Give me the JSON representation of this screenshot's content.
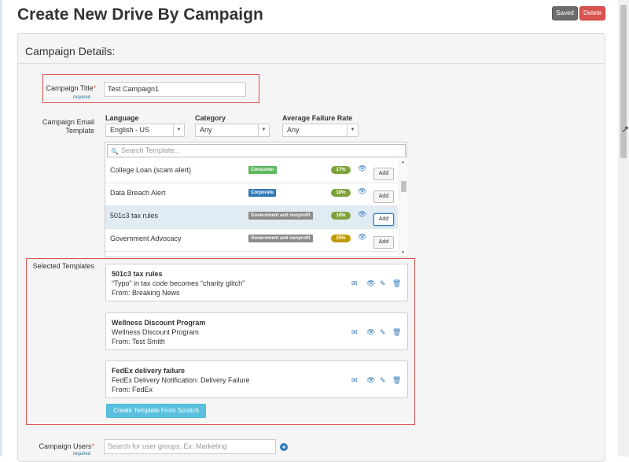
{
  "page": {
    "title": "Create New Drive By Campaign"
  },
  "actions": {
    "saved_label": "Saved",
    "delete_label": "Delete"
  },
  "panel": {
    "title": "Campaign Details:"
  },
  "campaign_title": {
    "label": "Campaign Title",
    "star": "*",
    "required_note": "required",
    "value": "Test Campaign1"
  },
  "email_template": {
    "label_line1": "Campaign Email",
    "label_line2": "Template",
    "language": {
      "label": "Language",
      "value": "English - US"
    },
    "category": {
      "label": "Category",
      "value": "Any"
    },
    "failure_rate": {
      "label": "Average Failure Rate",
      "value": "Any"
    },
    "search_placeholder": "Search Template...",
    "rows": [
      {
        "name": "College Loan (scam alert)",
        "tag": "Consumer",
        "tag_color": "#5cb85c",
        "pct": "17%",
        "pct_color": "#7fa33a",
        "add": "Add"
      },
      {
        "name": "Data Breach Alert",
        "tag": "Corporate",
        "tag_color": "#337ab7",
        "pct": "18%",
        "pct_color": "#7fa33a",
        "add": "Add"
      },
      {
        "name": "501c3 tax rules",
        "tag": "Government and nonprofit",
        "tag_color": "#8a8a8a",
        "pct": "18%",
        "pct_color": "#7fa33a",
        "add": "Add"
      },
      {
        "name": "Government Advocacy",
        "tag": "Government and nonprofit",
        "tag_color": "#8a8a8a",
        "pct": "25%",
        "pct_color": "#c09b00",
        "add": "Add"
      }
    ]
  },
  "selected_templates": {
    "label": "Selected Templates",
    "items": [
      {
        "title": "501c3 tax rules",
        "subject": "“Typo” in tax code becomes “charity glitch”",
        "from": "From: Breaking News"
      },
      {
        "title": "Wellness Discount Program",
        "subject": "Wellness Discount Program",
        "from": "From: Test Smith"
      },
      {
        "title": "FedEx delivery failure",
        "subject": "FedEx Delivery Notification: Delivery Failure",
        "from": "From: FedEx"
      }
    ],
    "create_button": "Create Template From Scratch"
  },
  "campaign_users": {
    "label": "Campaign Users",
    "star": "*",
    "required_note": "required",
    "placeholder": "Search for user groups. Ex: Marketing"
  }
}
